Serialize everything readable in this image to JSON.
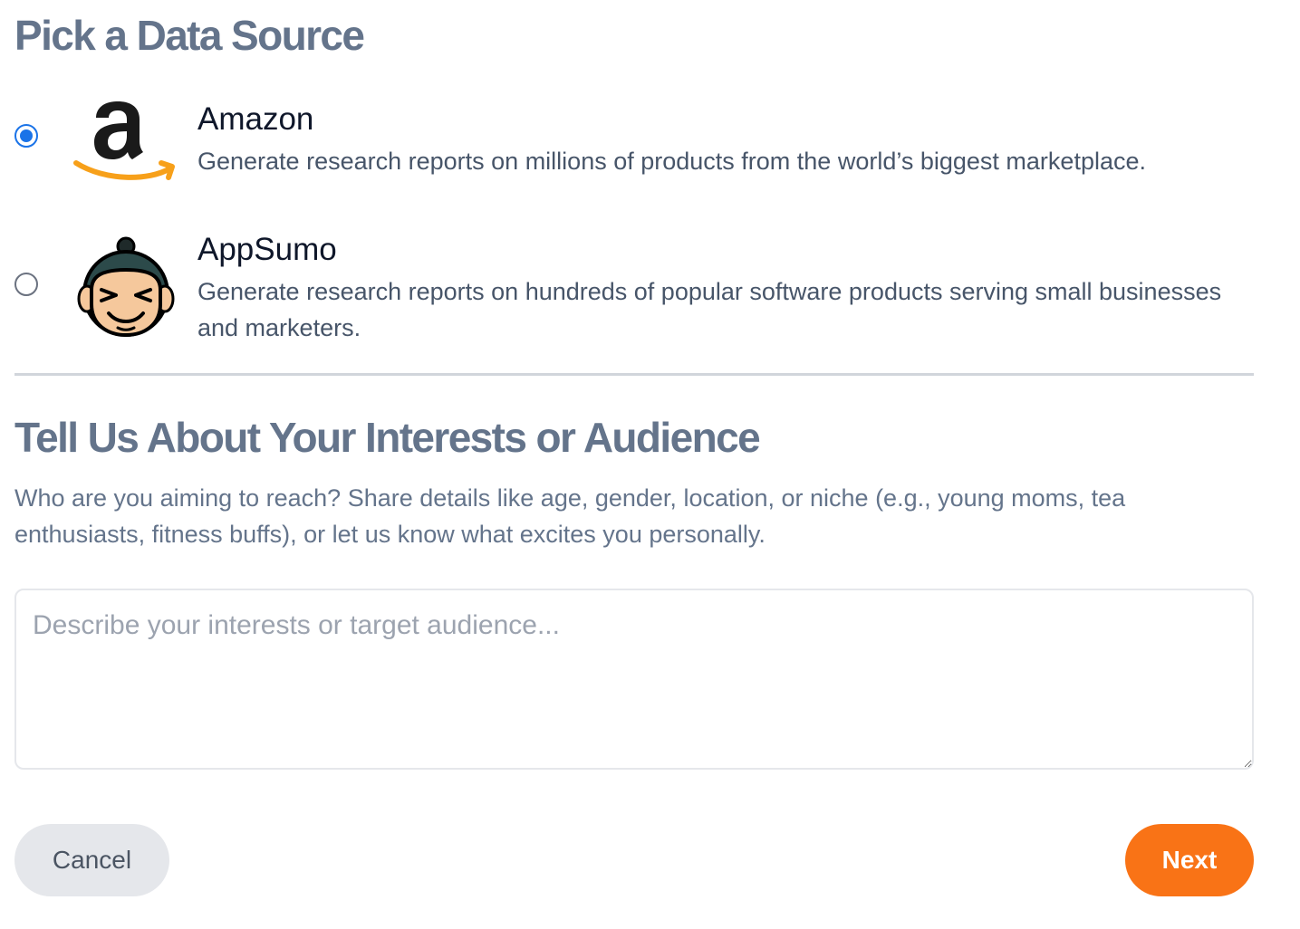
{
  "data_source": {
    "title": "Pick a Data Source",
    "options": [
      {
        "name": "Amazon",
        "description": "Generate research reports on millions of products from the world’s biggest marketplace.",
        "selected": true,
        "icon": "amazon-logo"
      },
      {
        "name": "AppSumo",
        "description": "Generate research reports on hundreds of popular software products serving small businesses and marketers.",
        "selected": false,
        "icon": "appsumo-logo"
      }
    ]
  },
  "interests": {
    "title": "Tell Us About Your Interests or Audience",
    "help": "Who are you aiming to reach? Share details like age, gender, location, or niche (e.g., young moms, tea enthusiasts, fitness buffs), or let us know what excites you personally.",
    "input": {
      "value": "",
      "placeholder": "Describe your interests or target audience..."
    }
  },
  "actions": {
    "cancel_label": "Cancel",
    "next_label": "Next"
  },
  "colors": {
    "accent": "#f97316",
    "radio": "#1a73e8",
    "heading": "#64748b"
  }
}
